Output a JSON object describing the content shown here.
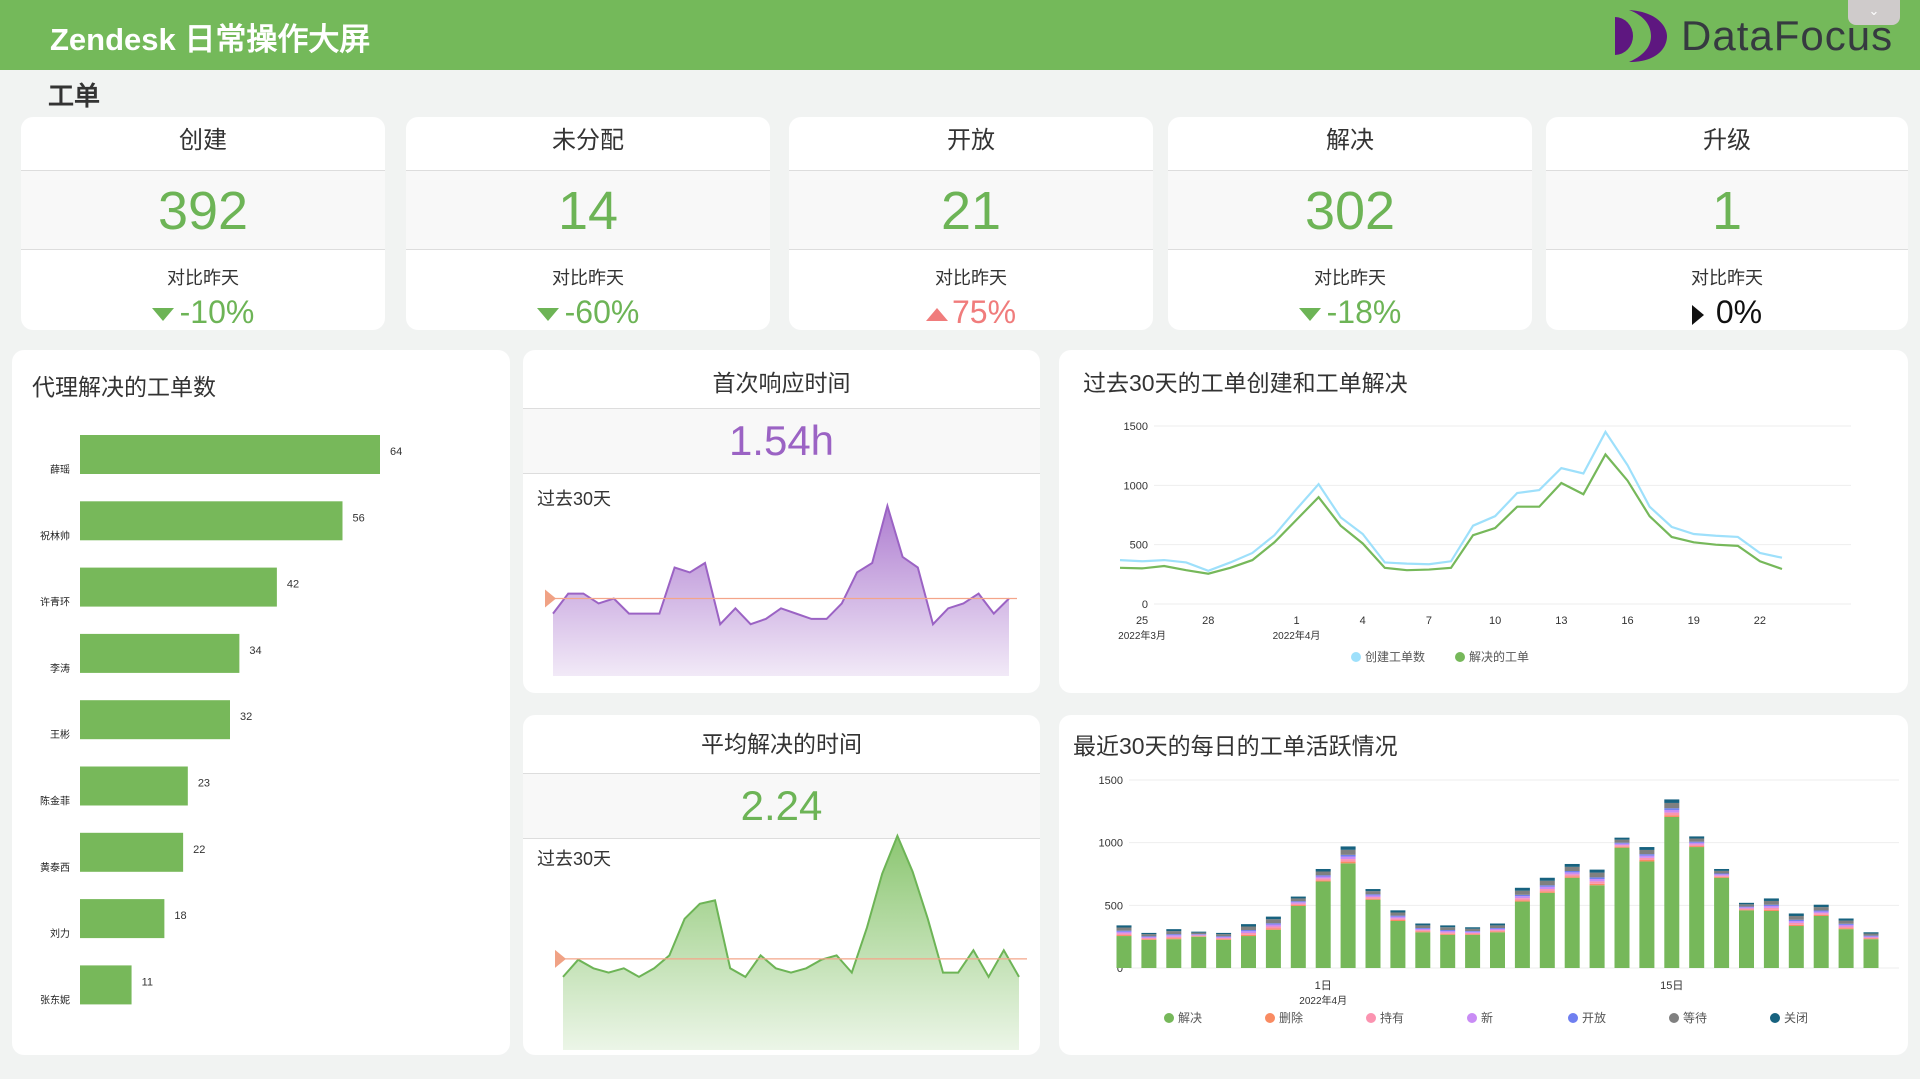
{
  "header": {
    "title": "Zendesk 日常操作大屏",
    "logo_text": "DataFocus",
    "dropdown_icon": "chevron-down-icon"
  },
  "section_title": "工单",
  "kpis": [
    {
      "label": "创建",
      "value": "392",
      "compare_label": "对比昨天",
      "change": "-10%",
      "trend": "down"
    },
    {
      "label": "未分配",
      "value": "14",
      "compare_label": "对比昨天",
      "change": "-60%",
      "trend": "down"
    },
    {
      "label": "开放",
      "value": "21",
      "compare_label": "对比昨天",
      "change": "75%",
      "trend": "up"
    },
    {
      "label": "解决",
      "value": "302",
      "compare_label": "对比昨天",
      "change": "-18%",
      "trend": "down"
    },
    {
      "label": "升级",
      "value": "1",
      "compare_label": "对比昨天",
      "change": "0%",
      "trend": "flat"
    }
  ],
  "colors": {
    "green": "#76b85a",
    "purple": "#9b63c4",
    "red": "#f07c7c",
    "header": "#74b95a",
    "light_blue": "#9ee0fb"
  },
  "first_response": {
    "title": "首次响应时间",
    "value": "1.54h",
    "sub": "过去30天"
  },
  "avg_resolve": {
    "title": "平均解决的时间",
    "value": "2.24",
    "sub": "过去30天"
  },
  "chart_data": [
    {
      "type": "bar",
      "title": "代理解决的工单数",
      "orientation": "horizontal",
      "categories": [
        "薛瑶",
        "祝林帅",
        "许青环",
        "李涛",
        "王彬",
        "陈金菲",
        "黄泰西",
        "刘力",
        "张东妮"
      ],
      "values": [
        64,
        56,
        42,
        34,
        32,
        23,
        22,
        18,
        11
      ]
    },
    {
      "type": "area",
      "title": "首次响应时间 过去30天",
      "reference": 2.05,
      "values": [
        1.65,
        2.18,
        2.18,
        1.92,
        2.05,
        1.65,
        1.65,
        1.65,
        2.87,
        2.74,
        2.99,
        1.37,
        1.79,
        1.37,
        1.51,
        1.79,
        1.65,
        1.51,
        1.51,
        1.92,
        2.74,
        2.99,
        4.5,
        3.15,
        2.87,
        1.37,
        1.79,
        1.92,
        2.18,
        1.65,
        2.05
      ]
    },
    {
      "type": "area",
      "title": "平均解决的时间 过去30天",
      "reference": 2.12,
      "values": [
        1.7,
        2.1,
        1.9,
        1.8,
        1.9,
        1.7,
        1.9,
        2.2,
        3.05,
        3.4,
        3.48,
        1.9,
        1.7,
        2.2,
        1.9,
        1.8,
        1.9,
        2.1,
        2.2,
        1.8,
        2.85,
        4.1,
        4.98,
        4.15,
        3.05,
        1.8,
        1.8,
        2.32,
        1.7,
        2.32,
        1.7
      ]
    },
    {
      "type": "line",
      "title": "过去30天的工单创建和工单解决",
      "ylim": [
        0,
        1500
      ],
      "yticks": [
        0,
        500,
        1000,
        1500
      ],
      "x_labels": [
        {
          "i": 1,
          "label": "25",
          "sub": "2022年3月"
        },
        {
          "i": 4,
          "label": "28"
        },
        {
          "i": 8,
          "label": "1",
          "sub": "2022年4月"
        },
        {
          "i": 11,
          "label": "4"
        },
        {
          "i": 14,
          "label": "7"
        },
        {
          "i": 17,
          "label": "10"
        },
        {
          "i": 20,
          "label": "13"
        },
        {
          "i": 23,
          "label": "16"
        },
        {
          "i": 26,
          "label": "19"
        },
        {
          "i": 29,
          "label": "22"
        }
      ],
      "series": [
        {
          "name": "创建工单数",
          "color": "#9ee0fb",
          "values": [
            370,
            360,
            370,
            350,
            280,
            350,
            430,
            580,
            800,
            1010,
            730,
            590,
            350,
            340,
            335,
            360,
            660,
            740,
            935,
            960,
            1145,
            1100,
            1450,
            1170,
            820,
            650,
            590,
            575,
            565,
            430,
            390
          ]
        },
        {
          "name": "解决的工单",
          "color": "#76b85a",
          "values": [
            305,
            300,
            320,
            285,
            255,
            305,
            370,
            520,
            710,
            900,
            660,
            510,
            305,
            285,
            290,
            305,
            580,
            640,
            820,
            820,
            1020,
            925,
            1260,
            1040,
            740,
            565,
            520,
            500,
            490,
            360,
            295
          ]
        }
      ]
    },
    {
      "type": "bar",
      "stacked": true,
      "title": "最近30天的每日的工单活跃情况",
      "ylim": [
        0,
        1500
      ],
      "yticks": [
        0,
        500,
        1000,
        1500
      ],
      "x_labels": [
        {
          "i": 8,
          "label": "1日",
          "sub": "2022年4月"
        },
        {
          "i": 22,
          "label": "15日"
        }
      ],
      "series": [
        {
          "name": "解决",
          "color": "#76b85a",
          "values": [
            255,
            225,
            230,
            250,
            225,
            255,
            305,
            495,
            690,
            835,
            545,
            375,
            285,
            265,
            265,
            285,
            530,
            600,
            720,
            660,
            960,
            850,
            1205,
            965,
            720,
            460,
            455,
            335,
            415,
            310,
            230
          ]
        },
        {
          "name": "删除",
          "color": "#f98b62",
          "values": [
            8,
            6,
            8,
            4,
            6,
            10,
            10,
            8,
            10,
            14,
            8,
            8,
            7,
            8,
            6,
            7,
            11,
            12,
            11,
            12,
            8,
            12,
            14,
            8,
            7,
            6,
            10,
            10,
            9,
            8,
            6
          ]
        },
        {
          "name": "持有",
          "color": "#fb93b0",
          "values": [
            13,
            8,
            12,
            6,
            8,
            14,
            16,
            11,
            15,
            20,
            13,
            13,
            10,
            11,
            9,
            10,
            16,
            18,
            16,
            19,
            12,
            17,
            21,
            13,
            10,
            9,
            15,
            15,
            13,
            13,
            8
          ]
        },
        {
          "name": "新",
          "color": "#c98cf5",
          "values": [
            13,
            8,
            12,
            6,
            8,
            14,
            16,
            11,
            15,
            20,
            13,
            13,
            10,
            11,
            9,
            10,
            16,
            18,
            16,
            19,
            12,
            17,
            21,
            13,
            10,
            9,
            15,
            15,
            13,
            13,
            8
          ]
        },
        {
          "name": "开放",
          "color": "#6f7ff0",
          "values": [
            9,
            6,
            8,
            4,
            6,
            10,
            10,
            8,
            10,
            14,
            9,
            9,
            7,
            8,
            6,
            7,
            11,
            12,
            11,
            13,
            8,
            12,
            14,
            9,
            7,
            6,
            10,
            10,
            9,
            9,
            6
          ]
        },
        {
          "name": "等待",
          "color": "#808080",
          "values": [
            25,
            17,
            24,
            12,
            17,
            28,
            32,
            22,
            30,
            40,
            25,
            25,
            21,
            22,
            18,
            21,
            33,
            36,
            33,
            38,
            24,
            34,
            42,
            25,
            21,
            18,
            30,
            30,
            27,
            25,
            17
          ]
        },
        {
          "name": "关闭",
          "color": "#17627f",
          "values": [
            17,
            10,
            16,
            8,
            10,
            19,
            21,
            15,
            20,
            27,
            17,
            17,
            15,
            15,
            12,
            15,
            23,
            24,
            23,
            24,
            16,
            23,
            28,
            17,
            15,
            12,
            20,
            20,
            19,
            17,
            10
          ]
        }
      ]
    }
  ]
}
